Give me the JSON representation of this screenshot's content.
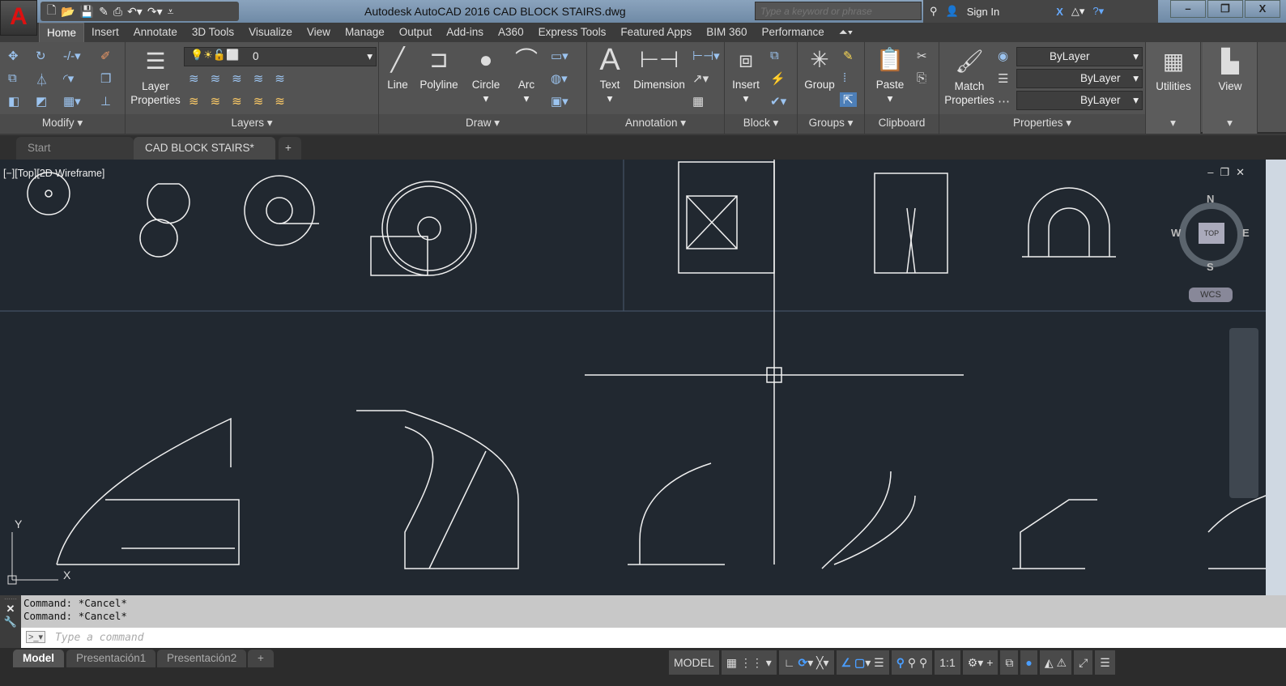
{
  "titlebar": {
    "app_title": "Autodesk AutoCAD 2016    CAD BLOCK STAIRS.dwg",
    "search_placeholder": "Type a keyword or phrase",
    "sign_in": "Sign In"
  },
  "ribbon_tabs": [
    "Home",
    "Insert",
    "Annotate",
    "3D Tools",
    "Visualize",
    "View",
    "Manage",
    "Output",
    "Add-ins",
    "A360",
    "Express Tools",
    "Featured Apps",
    "BIM 360",
    "Performance"
  ],
  "panels": {
    "modify": "Modify ▾",
    "layers": "Layers ▾",
    "draw": "Draw ▾",
    "annotation": "Annotation ▾",
    "block": "Block ▾",
    "groups": "Groups ▾",
    "clipboard": "Clipboard",
    "properties": "Properties ▾",
    "utilities": "Utilities",
    "view": "View"
  },
  "tools": {
    "layer_properties": "Layer Properties",
    "layer_current": "0",
    "line": "Line",
    "polyline": "Polyline",
    "circle": "Circle",
    "arc": "Arc",
    "text": "Text",
    "dimension": "Dimension",
    "insert": "Insert",
    "group": "Group",
    "paste": "Paste",
    "match_properties": "Match Properties",
    "color": "ByLayer",
    "linetype": "ByLayer",
    "lineweight": "ByLayer"
  },
  "file_tabs": {
    "start": "Start",
    "current": "CAD BLOCK STAIRS*"
  },
  "viewport": {
    "label": "[−][Top][2D Wireframe]",
    "viewcube": {
      "n": "N",
      "s": "S",
      "e": "E",
      "w": "W",
      "top": "TOP",
      "wcs": "WCS"
    },
    "ucs_x": "X",
    "ucs_y": "Y"
  },
  "command": {
    "history": [
      "Command: *Cancel*",
      "Command: *Cancel*"
    ],
    "placeholder": "Type a command"
  },
  "layout_tabs": [
    "Model",
    "Presentación1",
    "Presentación2"
  ],
  "status": {
    "model": "MODEL",
    "scale": "1:1"
  }
}
